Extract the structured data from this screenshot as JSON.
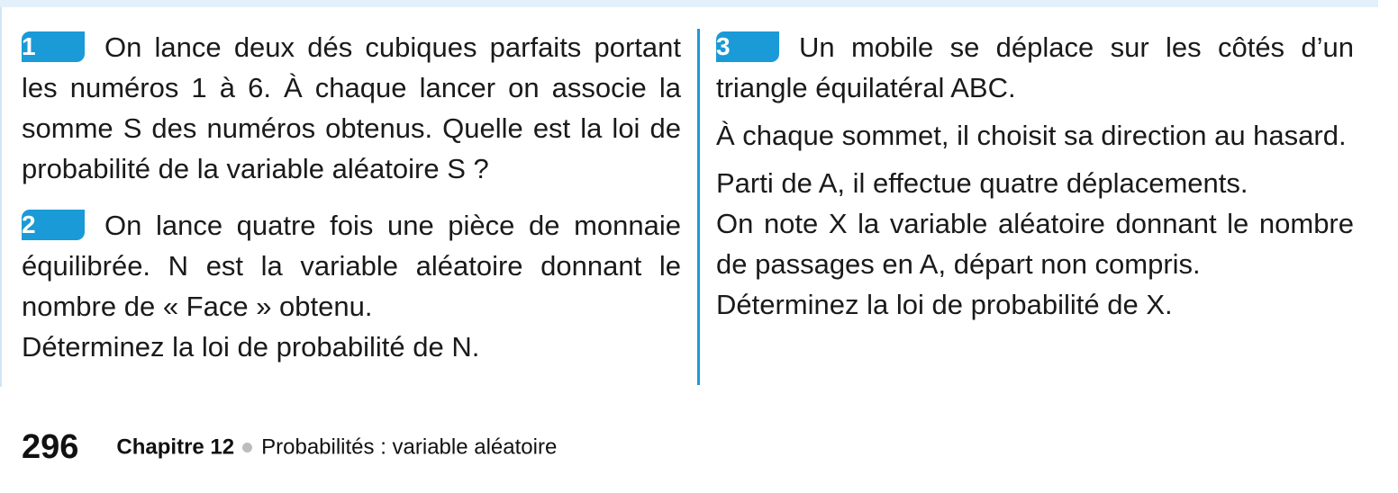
{
  "exercises": [
    {
      "number": "1",
      "text": "On lance deux dés cubiques parfaits portant les numéros 1 à 6. À chaque lancer on associe la somme S des numéros obtenus. Quelle est la loi de probabilité de la variable aléatoire S ?"
    },
    {
      "number": "2",
      "text": "On lance quatre fois une pièce de monnaie équilibrée. N est la variable aléatoire donnant le nombre de « Face » obtenu.",
      "question": "Déterminez la loi de probabilité de N."
    },
    {
      "number": "3",
      "text": "Un mobile se déplace sur les côtés d’un triangle équilatéral ABC.",
      "line2": "À chaque sommet, il choisit sa direction au hasard.",
      "line3": "Parti de A, il effectue quatre déplacements.",
      "line4": "On note X la variable aléatoire donnant le nombre de passages en A, départ non compris.",
      "question": "Déterminez la loi de probabilité de X."
    }
  ],
  "footer": {
    "page_number": "296",
    "chapter": "Chapitre 12",
    "title": "Probabilités : variable aléatoire"
  },
  "colors": {
    "accent": "#1a9ad6",
    "top_band": "#e1f0f9",
    "bullet": "#bdbdbd"
  }
}
